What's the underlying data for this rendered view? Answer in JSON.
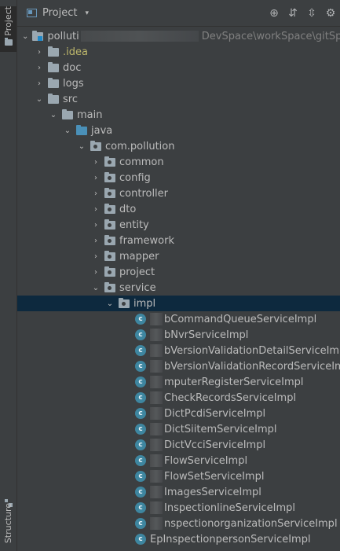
{
  "left_stripe": {
    "project_tab": "Project",
    "structure_tab": "Structure"
  },
  "header": {
    "title": "Project",
    "caret": "▾",
    "actions": [
      {
        "name": "locate",
        "icon": "crosshair-icon",
        "glyph": "⊕"
      },
      {
        "name": "expand-all",
        "icon": "expand-all-icon",
        "glyph": "⇵"
      },
      {
        "name": "collapse-all",
        "icon": "collapse-all-icon",
        "glyph": "⇳"
      },
      {
        "name": "settings",
        "icon": "gear-icon",
        "glyph": "⚙"
      }
    ]
  },
  "tree": {
    "root": {
      "label": "polluti",
      "path": "DevSpace\\workSpace\\gitSpa"
    },
    "top_folders": [
      {
        "label": ".idea"
      },
      {
        "label": "doc"
      },
      {
        "label": "logs"
      },
      {
        "label": "src"
      }
    ],
    "main": "main",
    "java": "java",
    "package": "com.pollution",
    "subpackages": [
      "common",
      "config",
      "controller",
      "dto",
      "entity",
      "framework",
      "mapper",
      "project",
      "service"
    ],
    "impl": "impl",
    "classes": [
      "bCommandQueueServiceImpl",
      "bNvrServiceImpl",
      "bVersionValidationDetailServiceImpl",
      "bVersionValidationRecordServiceImpl",
      "mputerRegisterServiceImpl",
      "CheckRecordsServiceImpl",
      "DictPcdiServiceImpl",
      "DictSiitemServiceImpl",
      "DictVcciServiceImpl",
      "FlowServiceImpl",
      "FlowSetServiceImpl",
      "ImagesServiceImpl",
      "InspectionlineServiceImpl",
      "nspectionorganizationServiceImpl",
      "EpInspectionpersonServiceImpl"
    ],
    "class_badge": "c"
  }
}
